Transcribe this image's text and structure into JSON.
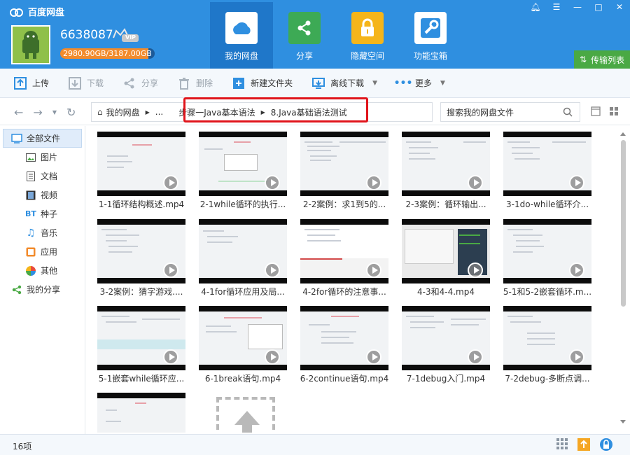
{
  "app": {
    "title": "百度网盘"
  },
  "user": {
    "name": "6638087",
    "vip": "VIP",
    "quota_text": "2980.90GB/3187.00GB",
    "quota_fraction": 0.935
  },
  "nav": {
    "tabs": [
      {
        "label": "我的网盘",
        "icon": "cloud-icon"
      },
      {
        "label": "分享",
        "icon": "share-icon"
      },
      {
        "label": "隐藏空间",
        "icon": "lock-icon"
      },
      {
        "label": "功能宝箱",
        "icon": "toolbox-icon"
      }
    ],
    "transfer": "传输列表"
  },
  "toolbar": {
    "upload": "上传",
    "download": "下载",
    "share": "分享",
    "delete": "删除",
    "new_folder": "新建文件夹",
    "offline": "离线下载",
    "more": "更多"
  },
  "address": {
    "home": "我的网盘",
    "ellipsis": "...",
    "crumb1": "步骤一Java基本语法",
    "crumb2": "8.Java基础语法测试",
    "search_placeholder": "搜索我的网盘文件"
  },
  "sidebar": {
    "all": "全部文件",
    "items": [
      "图片",
      "文档",
      "视频",
      "种子",
      "音乐",
      "应用",
      "其他"
    ],
    "bt_label": "BT",
    "share": "我的分享"
  },
  "files": [
    "1-1循环结构概述.mp4",
    "2-1while循环的执行...",
    "2-2案例：求1到5的...",
    "2-3案例：循环输出...",
    "3-1do-while循环介...",
    "3-2案例：猜字游戏....",
    "4-1for循环应用及局...",
    "4-2for循环的注意事...",
    "4-3和4-4.mp4",
    "5-1和5-2嵌套循环.m...",
    "5-1嵌套while循环应...",
    "6-1break语句.mp4",
    "6-2continue语句.mp4",
    "7-1debug入门.mp4",
    "7-2debug-多断点调...",
    ""
  ],
  "status": {
    "count": "16项"
  },
  "colors": {
    "header": "#2f8fe0",
    "active_tab": "#1f77c9",
    "transfer": "#4aa944",
    "highlight": "#e0141b"
  }
}
